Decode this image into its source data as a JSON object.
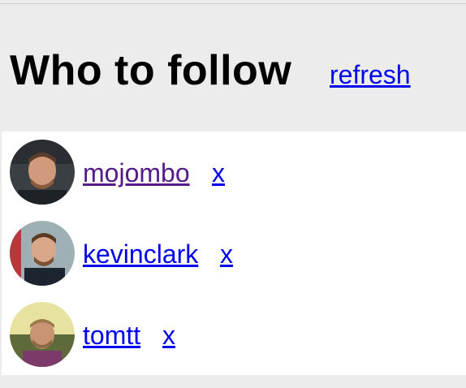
{
  "header": {
    "title": "Who to follow",
    "refresh_label": "refresh"
  },
  "suggestions": [
    {
      "username": "mojombo",
      "close_label": "x",
      "visited": true
    },
    {
      "username": "kevinclark",
      "close_label": "x",
      "visited": false
    },
    {
      "username": "tomtt",
      "close_label": "x",
      "visited": false
    }
  ],
  "colors": {
    "link": "#0000ee",
    "visited_link": "#551a8b",
    "header_bg": "#ececec",
    "list_bg": "#ffffff"
  }
}
